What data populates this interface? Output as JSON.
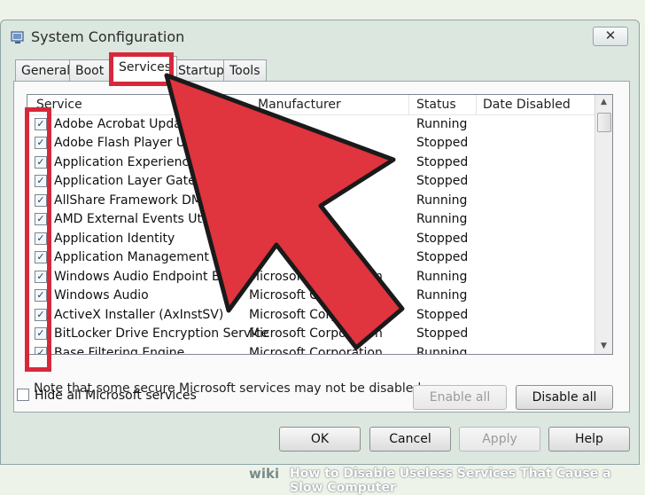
{
  "window": {
    "title": "System Configuration",
    "close_label": "✕"
  },
  "tabs": [
    {
      "label": "General",
      "active": false
    },
    {
      "label": "Boot",
      "active": false
    },
    {
      "label": "Services",
      "active": true
    },
    {
      "label": "Startup",
      "active": false
    },
    {
      "label": "Tools",
      "active": false
    }
  ],
  "columns": {
    "service": "Service",
    "manufacturer": "Manufacturer",
    "status": "Status",
    "date_disabled": "Date Disabled"
  },
  "services": [
    {
      "name": "Adobe Acrobat Update S",
      "manufacturer": "",
      "status": "Running",
      "checked": true
    },
    {
      "name": "Adobe Flash Player Update",
      "manufacturer": "",
      "status": "Stopped",
      "checked": true
    },
    {
      "name": "Application Experience",
      "manufacturer": "",
      "status": "Stopped",
      "checked": true
    },
    {
      "name": "Application Layer Gateway Se",
      "manufacturer": "",
      "status": "Stopped",
      "checked": true
    },
    {
      "name": "AllShare Framework DMS",
      "manufacturer": "",
      "status": "Running",
      "checked": true
    },
    {
      "name": "AMD External Events Utility",
      "manufacturer": "",
      "status": "Running",
      "checked": true
    },
    {
      "name": "Application Identity",
      "manufacturer": "",
      "status": "Stopped",
      "checked": true
    },
    {
      "name": "Application Management",
      "manufacturer": "",
      "status": "Stopped",
      "checked": true
    },
    {
      "name": "Windows Audio Endpoint Builder",
      "manufacturer": "Microsoft Corporation",
      "status": "Running",
      "checked": true
    },
    {
      "name": "Windows Audio",
      "manufacturer": "Microsoft Corporation",
      "status": "Running",
      "checked": true
    },
    {
      "name": "ActiveX Installer (AxInstSV)",
      "manufacturer": "Microsoft Corporation",
      "status": "Stopped",
      "checked": true
    },
    {
      "name": "BitLocker Drive Encryption Service",
      "manufacturer": "Microsoft Corporation",
      "status": "Stopped",
      "checked": true
    },
    {
      "name": "Base Filtering Engine",
      "manufacturer": "Microsoft Corporation",
      "status": "Running",
      "checked": true
    }
  ],
  "note": "Note that some secure Microsoft services may not be disabled.",
  "buttons": {
    "enable_all": "Enable all",
    "disable_all": "Disable all",
    "ok": "OK",
    "cancel": "Cancel",
    "apply": "Apply",
    "help": "Help"
  },
  "hide_ms": {
    "label": "Hide all Microsoft services",
    "checked": false
  },
  "footer": {
    "wiki": "wiki",
    "text": "How to Disable Useless Services That Cause a Slow Computer"
  },
  "colors": {
    "highlight": "#d7283a"
  }
}
